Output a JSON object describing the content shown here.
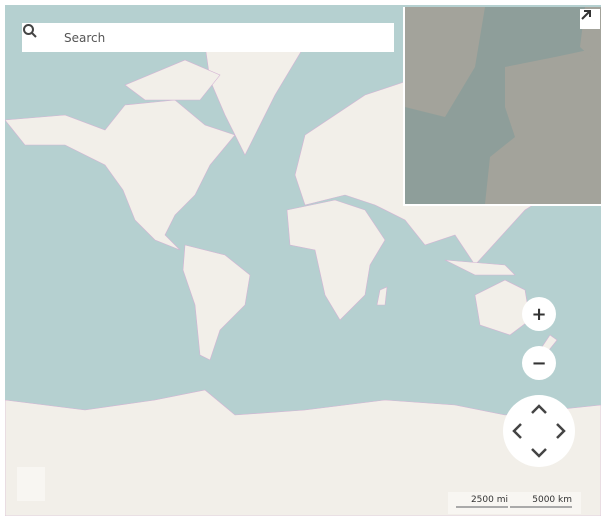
{
  "search": {
    "placeholder": "Search",
    "icon": "search-icon"
  },
  "minimap": {
    "expand_icon": "arrow-up-right-icon"
  },
  "zoom": {
    "in_label": "+",
    "out_label": "−"
  },
  "scale": {
    "imperial": "2500 mi",
    "metric": "5000 km"
  },
  "colors": {
    "ocean": "#b5d0d0",
    "land": "#f2efe9",
    "borders": "#c9a0c9"
  }
}
